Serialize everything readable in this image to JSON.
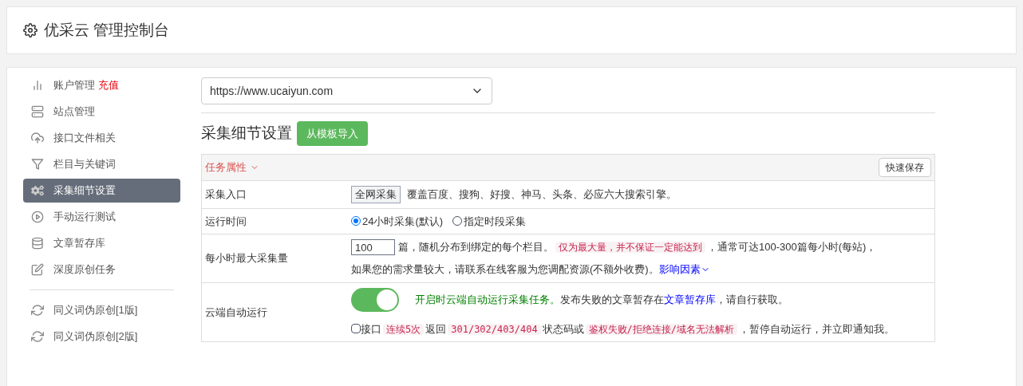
{
  "header": {
    "title": "优采云 管理控制台"
  },
  "sidebar": {
    "items": [
      {
        "kind": "account",
        "label": "账户管理",
        "badge": "充值",
        "selected": false
      },
      {
        "kind": "server",
        "label": "站点管理",
        "selected": false
      },
      {
        "kind": "upload",
        "label": "接口文件相关",
        "selected": false
      },
      {
        "kind": "filter",
        "label": "栏目与关键词",
        "selected": false
      },
      {
        "kind": "gears",
        "label": "采集细节设置",
        "selected": true
      },
      {
        "kind": "play",
        "label": "手动运行测试",
        "selected": false
      },
      {
        "kind": "database",
        "label": "文章暂存库",
        "selected": false
      },
      {
        "kind": "edit",
        "label": "深度原创任务",
        "selected": false
      },
      {
        "kind": "divider"
      },
      {
        "kind": "refresh",
        "label": "同义词伪原创[1版]",
        "selected": false
      },
      {
        "kind": "refresh",
        "label": "同义词伪原创[2版]",
        "selected": false
      }
    ]
  },
  "site_select": {
    "value": "https://www.ucaiyun.com"
  },
  "section": {
    "title": "采集细节设置",
    "import_button": "从模板导入"
  },
  "panel": {
    "title": "任务属性",
    "save_button": "快速保存"
  },
  "rows": [
    {
      "kind": "entry",
      "label": "采集入口",
      "button": "全网采集",
      "text": "覆盖百度、搜狗、好搜、神马、头条、必应六大搜索引擎。"
    },
    {
      "kind": "radio",
      "label": "运行时间",
      "options": [
        {
          "label": "24小时采集(默认)",
          "selected": true
        },
        {
          "label": "指定时段采集",
          "selected": false
        }
      ]
    },
    {
      "kind": "count",
      "label": "每小时最大采集量",
      "value": "100",
      "line1": [
        {
          "kind": "plain",
          "text": "篇，随机分布到绑定的每个栏目。"
        },
        {
          "kind": "code",
          "text": "仅为最大量，并不保证一定能达到"
        },
        {
          "kind": "plain",
          "text": "，通常可达100-300篇每小时(每站)，"
        }
      ],
      "line2": [
        {
          "kind": "plain",
          "text": "如果您的需求量较大，请联系在线客服为您调配资源(不额外收费)。"
        },
        {
          "kind": "link",
          "text": "影响因素"
        }
      ]
    },
    {
      "kind": "cloud",
      "label": "云端自动运行",
      "on": true,
      "parts": [
        {
          "kind": "green",
          "text": "开启时云端自动运行采集任务。"
        },
        {
          "kind": "plain",
          "text": "发布失败的文章暂存在"
        },
        {
          "kind": "link",
          "text": "文章暂存库"
        },
        {
          "kind": "plain",
          "text": "，请自行获取。"
        }
      ],
      "check": {
        "checked": false,
        "parts": [
          {
            "kind": "plain",
            "text": "接口"
          },
          {
            "kind": "code",
            "text": "连续5次"
          },
          {
            "kind": "plain",
            "text": "返回"
          },
          {
            "kind": "code",
            "text": "301/302/403/404"
          },
          {
            "kind": "plain",
            "text": "状态码或"
          },
          {
            "kind": "code",
            "text": "鉴权失败/拒绝连接/域名无法解析"
          },
          {
            "kind": "plain",
            "text": "，暂停自动运行，并立即通知我。"
          }
        ]
      }
    }
  ]
}
